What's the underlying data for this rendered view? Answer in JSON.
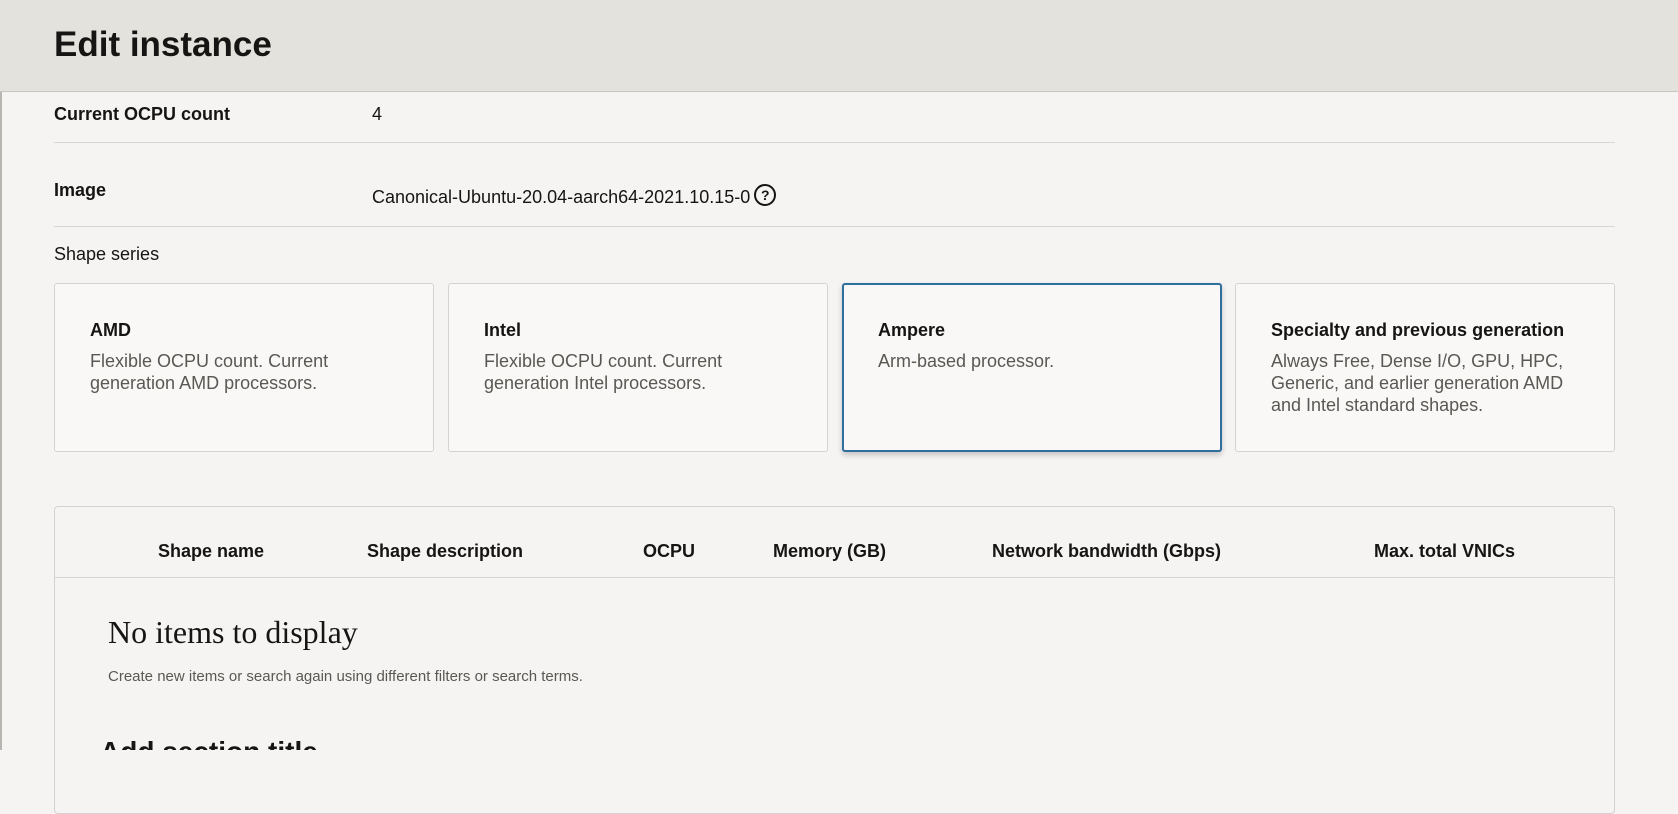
{
  "header": {
    "title": "Edit instance"
  },
  "details": {
    "ocpu_label": "Current OCPU count",
    "ocpu_value": "4",
    "image_label": "Image",
    "image_value": "Canonical-Ubuntu-20.04-aarch64-2021.10.15-0",
    "help_icon": "?"
  },
  "shape_series": {
    "label": "Shape series",
    "cards": [
      {
        "title": "AMD",
        "desc_line1": "Flexible OCPU count. Current",
        "desc_line2": "generation AMD processors.",
        "desc_line3": "",
        "selected": false
      },
      {
        "title": "Intel",
        "desc_line1": "Flexible OCPU count. Current",
        "desc_line2": "generation Intel processors.",
        "desc_line3": "",
        "selected": false
      },
      {
        "title": "Ampere",
        "desc_line1": "Arm-based processor.",
        "desc_line2": "",
        "desc_line3": "",
        "selected": true
      },
      {
        "title": "Specialty and previous generation",
        "desc_line1": "Always Free, Dense I/O, GPU, HPC,",
        "desc_line2": "Generic, and earlier generation AMD",
        "desc_line3": "and Intel standard shapes.",
        "selected": false
      }
    ],
    "selected_border_color": "#2f6f9c"
  },
  "table": {
    "columns": [
      "Shape name",
      "Shape description",
      "OCPU",
      "Memory (GB)",
      "Network bandwidth (Gbps)",
      "Max. total VNICs"
    ],
    "empty_title": "No items to display",
    "empty_description": "Create new items or search again using different filters or search terms."
  },
  "next_section_heading_partial": "Add section title"
}
